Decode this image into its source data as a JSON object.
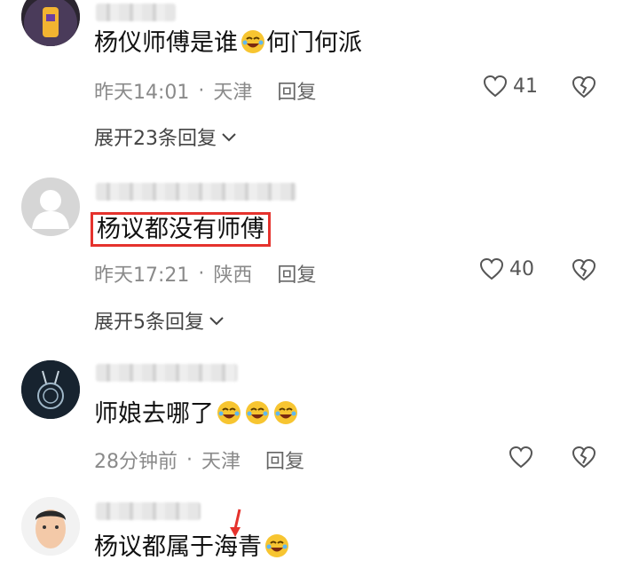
{
  "comments": [
    {
      "text": "杨仪师傅是谁",
      "text_after": "何门何派",
      "time": "昨天14:01",
      "sep": "·",
      "location": "天津",
      "reply_label": "回复",
      "likes": "41",
      "expand_label": "展开23条回复"
    },
    {
      "text": "杨议都没有师傅",
      "time": "昨天17:21",
      "sep": "·",
      "location": "陕西",
      "reply_label": "回复",
      "likes": "40",
      "expand_label": "展开5条回复"
    },
    {
      "text": "师娘去哪了",
      "time": "28分钟前",
      "sep": "·",
      "location": "天津",
      "reply_label": "回复"
    },
    {
      "text": "杨议都属于海青"
    }
  ],
  "icons": {
    "like": "heart-outline-icon",
    "dislike": "broken-heart-icon",
    "expand": "chevron-down-icon",
    "emoji": "rolling-laughing-emoji-icon"
  },
  "colors": {
    "highlight_border": "#e5322d",
    "meta_text": "#8a8a8a",
    "emoji_yellow": "#f7c531",
    "arrow_red": "#e5322d"
  }
}
